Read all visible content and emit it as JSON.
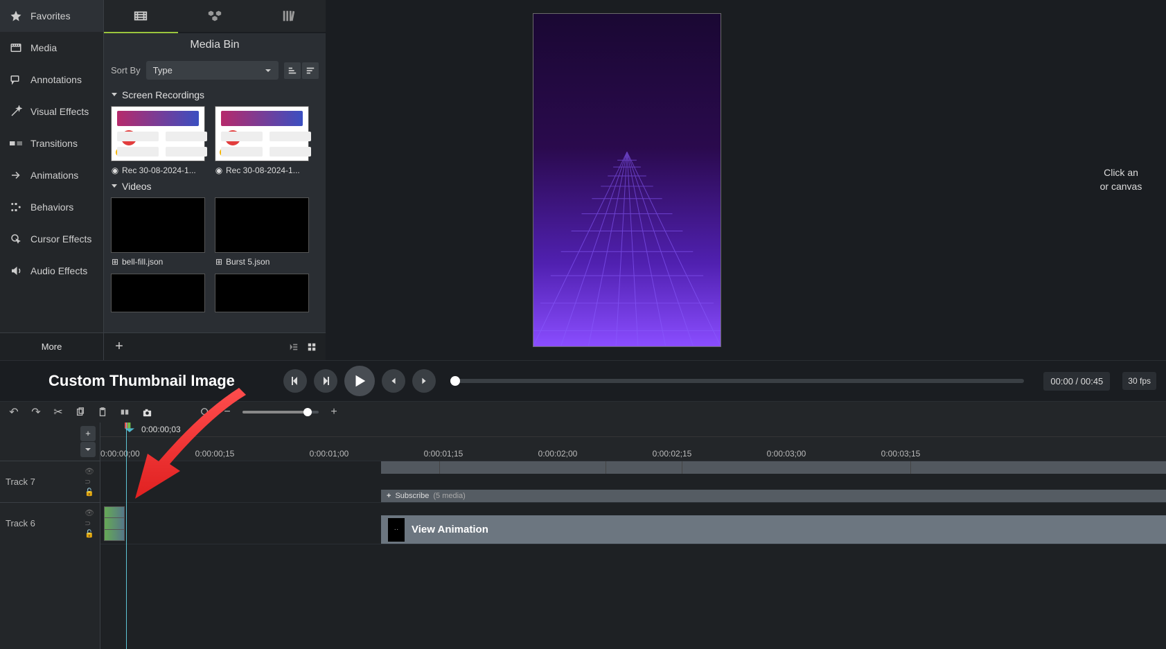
{
  "sidebar": {
    "items": [
      {
        "label": "Favorites",
        "icon": "star"
      },
      {
        "label": "Media",
        "icon": "film"
      },
      {
        "label": "Annotations",
        "icon": "callout"
      },
      {
        "label": "Visual Effects",
        "icon": "wand"
      },
      {
        "label": "Transitions",
        "icon": "transition"
      },
      {
        "label": "Animations",
        "icon": "animation"
      },
      {
        "label": "Behaviors",
        "icon": "behavior"
      },
      {
        "label": "Cursor Effects",
        "icon": "cursor"
      },
      {
        "label": "Audio Effects",
        "icon": "audio"
      }
    ],
    "more_label": "More"
  },
  "tabs": {
    "active_index": 0
  },
  "media_bin": {
    "title": "Media Bin",
    "sort_by_label": "Sort By",
    "sort_value": "Type",
    "sections": [
      {
        "title": "Screen Recordings",
        "items": [
          {
            "caption": "Rec 30-08-2024-1...",
            "badge": "record",
            "dot": true
          },
          {
            "caption": "Rec 30-08-2024-1...",
            "badge": "record",
            "dot": true
          }
        ]
      },
      {
        "title": "Videos",
        "items": [
          {
            "caption": "bell-fill.json",
            "badge": "json"
          },
          {
            "caption": "Burst 5.json",
            "badge": "json"
          }
        ]
      }
    ]
  },
  "preview": {
    "right_hint_line1": "Click an",
    "right_hint_line2": "or canvas"
  },
  "playback": {
    "annotation": "Custom Thumbnail Image",
    "time": "00:00 / 00:45",
    "fps": "30 fps"
  },
  "timeline": {
    "playhead_time": "0:00:00;03",
    "ruler_labels": [
      "0:00:00;00",
      "0:00:00;15",
      "0:00:01;00",
      "0:00:01;15",
      "0:00:02;00",
      "0:00:02;15",
      "0:00:03;00",
      "0:00:03;15"
    ],
    "tracks": [
      {
        "name": "Track 7"
      },
      {
        "name": "Track 6"
      }
    ],
    "subscribe_group": {
      "label": "Subscribe",
      "count_label": "(5 media)"
    },
    "view_animation_label": "View Animation"
  }
}
